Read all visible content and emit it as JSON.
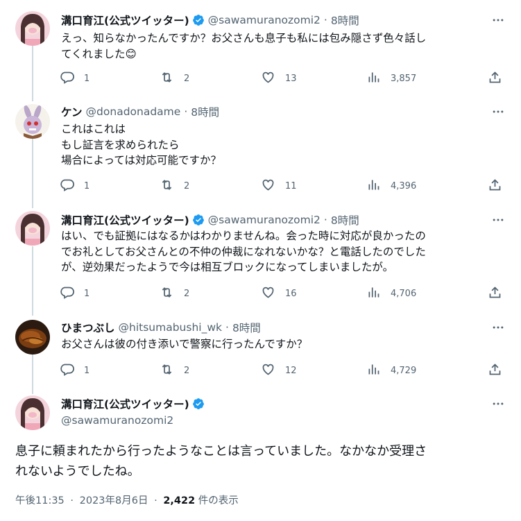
{
  "tweets": [
    {
      "name": "溝口育江(公式ツイッター)",
      "handle": "@sawamuranozomi2",
      "sep": "·",
      "time": "8時間",
      "verified": true,
      "lines": [
        "えっ、知らなかったんですか？お父さんも息子も私には包み隠さず色々話し",
        "てくれました😊"
      ],
      "replies": "1",
      "retweets": "2",
      "likes": "13",
      "views": "3,857"
    },
    {
      "name": "ケン",
      "handle": "@donadonadame",
      "sep": "·",
      "time": "8時間",
      "verified": false,
      "lines": [
        "これはこれは",
        "もし証言を求められたら",
        "場合によっては対応可能ですか？"
      ],
      "replies": "1",
      "retweets": "2",
      "likes": "11",
      "views": "4,396"
    },
    {
      "name": "溝口育江(公式ツイッター)",
      "handle": "@sawamuranozomi2",
      "sep": "·",
      "time": "8時間",
      "verified": true,
      "lines": [
        "はい、でも証拠にはなるかはわかりませんね。会った時に対応が良かったの",
        "でお礼としてお父さんとの不仲の仲裁になれないかな？と電話したのでした",
        "が、逆効果だったようで今は相互ブロックになってしまいましたが。"
      ],
      "replies": "1",
      "retweets": "2",
      "likes": "16",
      "views": "4,706"
    },
    {
      "name": "ひまつぶし",
      "handle": "@hitsumabushi_wk",
      "sep": "·",
      "time": "8時間",
      "verified": false,
      "lines": [
        "お父さんは彼の付き添いで警察に行ったんですか？"
      ],
      "replies": "1",
      "retweets": "2",
      "likes": "12",
      "views": "4,729"
    }
  ],
  "main": {
    "name": "溝口育江(公式ツイッター)",
    "handle": "@sawamuranozomi2",
    "lines": [
      "息子に頼まれたから行ったようなことは言っていました。なかなか受理さ",
      "れないようでしたね。"
    ],
    "time": "午後11:35",
    "sep": "·",
    "date": "2023年8月6日",
    "sep2": "·",
    "views": "2,422",
    "views_suffix": " 件の表示"
  },
  "colors": {
    "text": "#0f1419",
    "secondary": "#536471",
    "verified": "#1d9bf0",
    "line": "#cfd9de"
  },
  "icons": [
    "reply-icon",
    "retweet-icon",
    "like-icon",
    "views-icon",
    "share-icon",
    "more-icon",
    "verified-icon"
  ]
}
